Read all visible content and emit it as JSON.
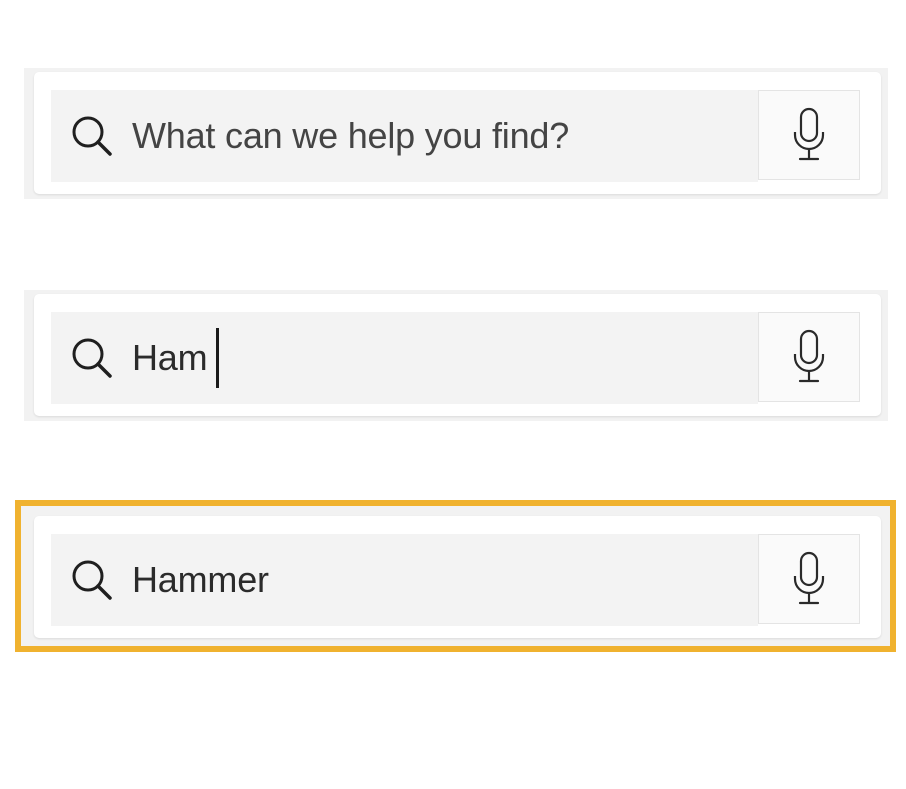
{
  "search_bars": [
    {
      "state": "empty",
      "placeholder": "What can we help you find?",
      "value": "",
      "icons": {
        "search": "search-icon",
        "mic": "microphone-icon"
      }
    },
    {
      "state": "typing",
      "placeholder": "",
      "value": "Ham",
      "icons": {
        "search": "search-icon",
        "mic": "microphone-icon"
      }
    },
    {
      "state": "completed",
      "placeholder": "",
      "value": "Hammer",
      "highlighted": true,
      "icons": {
        "search": "search-icon",
        "mic": "microphone-icon"
      }
    }
  ],
  "colors": {
    "highlight_border": "#f0b22f",
    "field_background": "#f3f3f3",
    "text": "#2b2b2b"
  }
}
